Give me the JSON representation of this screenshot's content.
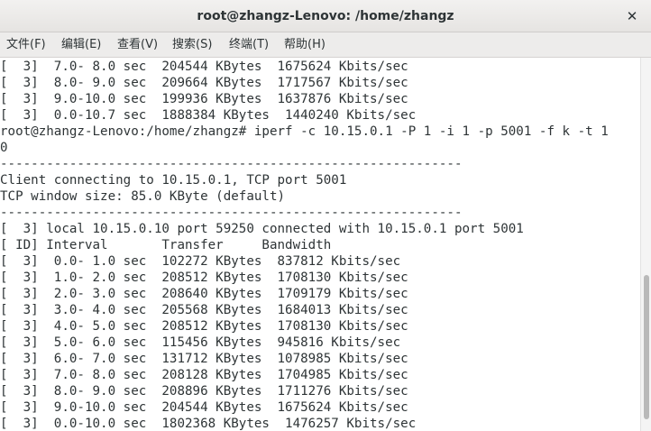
{
  "window": {
    "title": "root@zhangz-Lenovo: /home/zhangz",
    "close_glyph": "✕"
  },
  "menu": [
    {
      "name": "menu-file",
      "label": "文件(F)"
    },
    {
      "name": "menu-edit",
      "label": "编辑(E)"
    },
    {
      "name": "menu-view",
      "label": "查看(V)"
    },
    {
      "name": "menu-search",
      "label": "搜索(S)"
    },
    {
      "name": "menu-terminal",
      "label": "终端(T)"
    },
    {
      "name": "menu-help",
      "label": "帮助(H)"
    }
  ],
  "terminal": {
    "lines": [
      "[  3]  7.0- 8.0 sec  204544 KBytes  1675624 Kbits/sec",
      "[  3]  8.0- 9.0 sec  209664 KBytes  1717567 Kbits/sec",
      "[  3]  9.0-10.0 sec  199936 KBytes  1637876 Kbits/sec",
      "[  3]  0.0-10.7 sec  1888384 KBytes  1440240 Kbits/sec",
      "root@zhangz-Lenovo:/home/zhangz# iperf -c 10.15.0.1 -P 1 -i 1 -p 5001 -f k -t 1",
      "0",
      "------------------------------------------------------------",
      "Client connecting to 10.15.0.1, TCP port 5001",
      "TCP window size: 85.0 KByte (default)",
      "------------------------------------------------------------",
      "[  3] local 10.15.0.10 port 59250 connected with 10.15.0.1 port 5001",
      "[ ID] Interval       Transfer     Bandwidth",
      "[  3]  0.0- 1.0 sec  102272 KBytes  837812 Kbits/sec",
      "[  3]  1.0- 2.0 sec  208512 KBytes  1708130 Kbits/sec",
      "[  3]  2.0- 3.0 sec  208640 KBytes  1709179 Kbits/sec",
      "[  3]  3.0- 4.0 sec  205568 KBytes  1684013 Kbits/sec",
      "[  3]  4.0- 5.0 sec  208512 KBytes  1708130 Kbits/sec",
      "[  3]  5.0- 6.0 sec  115456 KBytes  945816 Kbits/sec",
      "[  3]  6.0- 7.0 sec  131712 KBytes  1078985 Kbits/sec",
      "[  3]  7.0- 8.0 sec  208128 KBytes  1704985 Kbits/sec",
      "[  3]  8.0- 9.0 sec  208896 KBytes  1711276 Kbits/sec",
      "[  3]  9.0-10.0 sec  204544 KBytes  1675624 Kbits/sec",
      "[  3]  0.0-10.0 sec  1802368 KBytes  1476257 Kbits/sec"
    ]
  }
}
